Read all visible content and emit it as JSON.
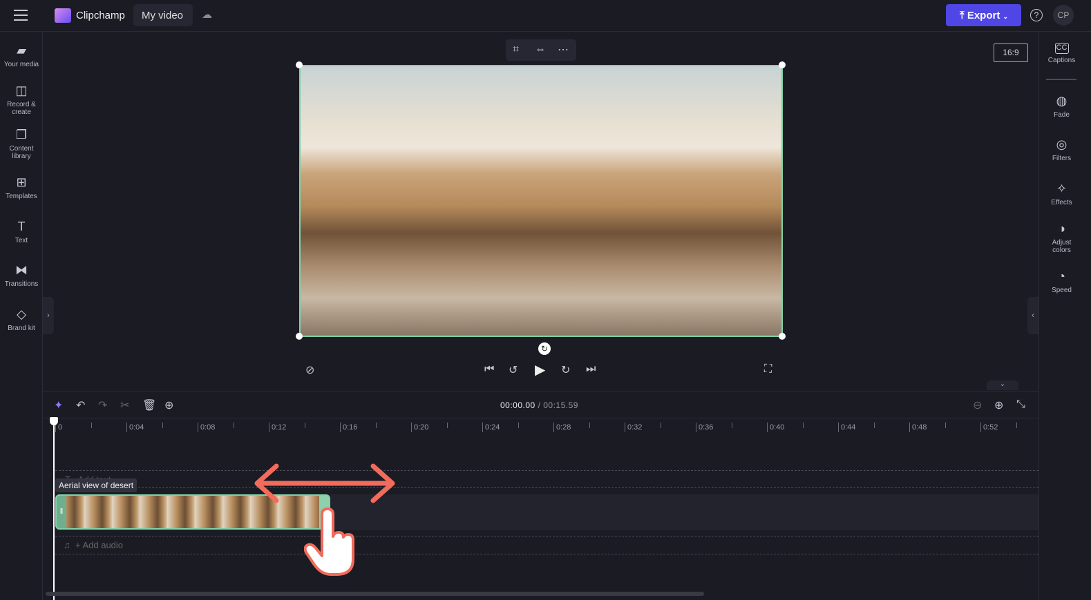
{
  "topbar": {
    "app_name": "Clipchamp",
    "project_name": "My video",
    "export_label": "Export",
    "avatar_initials": "CP",
    "accent": "#4f46e5"
  },
  "left_sidebar": [
    {
      "label": "Your media",
      "icon": "folder-icon"
    },
    {
      "label": "Record & create",
      "icon": "camera-icon"
    },
    {
      "label": "Content library",
      "icon": "library-icon"
    },
    {
      "label": "Templates",
      "icon": "templates-icon"
    },
    {
      "label": "Text",
      "icon": "text-icon"
    },
    {
      "label": "Transitions",
      "icon": "transitions-icon"
    },
    {
      "label": "Brand kit",
      "icon": "brand-kit-icon"
    }
  ],
  "right_sidebar": [
    {
      "label": "Captions",
      "icon": "captions-icon"
    },
    {
      "label": "Fade",
      "icon": "fade-icon"
    },
    {
      "label": "Filters",
      "icon": "filters-icon"
    },
    {
      "label": "Effects",
      "icon": "effects-icon"
    },
    {
      "label": "Adjust colors",
      "icon": "adjust-colors-icon"
    },
    {
      "label": "Speed",
      "icon": "speed-icon"
    }
  ],
  "preview": {
    "aspect_ratio": "16:9"
  },
  "timeline": {
    "current_time": "00:00.00",
    "total_time": "/ 00:15.59",
    "ruler": [
      "0",
      "0:04",
      "0:08",
      "0:12",
      "0:16",
      "0:20",
      "0:24",
      "0:28",
      "0:32",
      "0:36",
      "0:40",
      "0:44",
      "0:48",
      "0:52"
    ],
    "clip_name": "Aerial view of desert",
    "add_text": "Add text",
    "add_audio": "+ Add audio"
  }
}
